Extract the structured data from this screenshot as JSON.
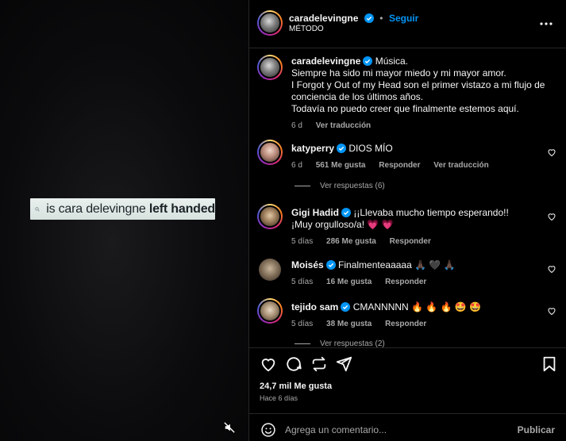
{
  "media": {
    "search_query_normal": "is cara delevingne ",
    "search_query_bold": "left handed",
    "mute_icon": "speaker-muted-icon"
  },
  "post_header": {
    "username": "caradelevingne",
    "follow_label": "Seguir",
    "subtitle": "MÉTODO",
    "more_icon": "more-horizontal-icon"
  },
  "caption": {
    "username": "caradelevingne",
    "lines": [
      "Música.",
      "Siempre ha sido mi mayor miedo y mi mayor amor.",
      "I Forgot y Out of my Head son el primer vistazo a mi flujo de conciencia de los últimos años.",
      "Todavía no puedo creer que finalmente estemos aquí."
    ],
    "time": "6 d",
    "translate": "Ver traducción"
  },
  "comments": [
    {
      "username": "katyperry",
      "verified": true,
      "text": "DIOS MÍO",
      "time": "6 d",
      "likes": "561 Me gusta",
      "reply": "Responder",
      "translate": "Ver traducción",
      "replies": "Ver respuestas (6)"
    },
    {
      "username": "Gigi Hadid",
      "verified": true,
      "text": "¡¡Llevaba mucho tiempo esperando!! ¡Muy orgulloso/a! 💗 💗",
      "time": "5 días",
      "likes": "286 Me gusta",
      "reply": "Responder"
    },
    {
      "username": "Moisés",
      "verified": true,
      "text": "Finalmenteaaaaa 🙏🏿 🖤 🙏🏿",
      "time": "5 días",
      "likes": "16 Me gusta",
      "reply": "Responder"
    },
    {
      "username": "tejido sam",
      "verified": true,
      "text": "CMANNNNN 🔥 🔥 🔥 🤩 🤩",
      "time": "5 días",
      "likes": "38 Me gusta",
      "reply": "Responder",
      "replies": "Ver respuestas (2)"
    }
  ],
  "actions": {
    "likes_count": "24,7 mil Me gusta",
    "posted": "Hace 6 días"
  },
  "composer": {
    "placeholder": "Agrega un comentario...",
    "publish": "Publicar"
  },
  "colors": {
    "accent": "#0095f6",
    "muted": "#a8a8a8",
    "background": "#000000"
  }
}
